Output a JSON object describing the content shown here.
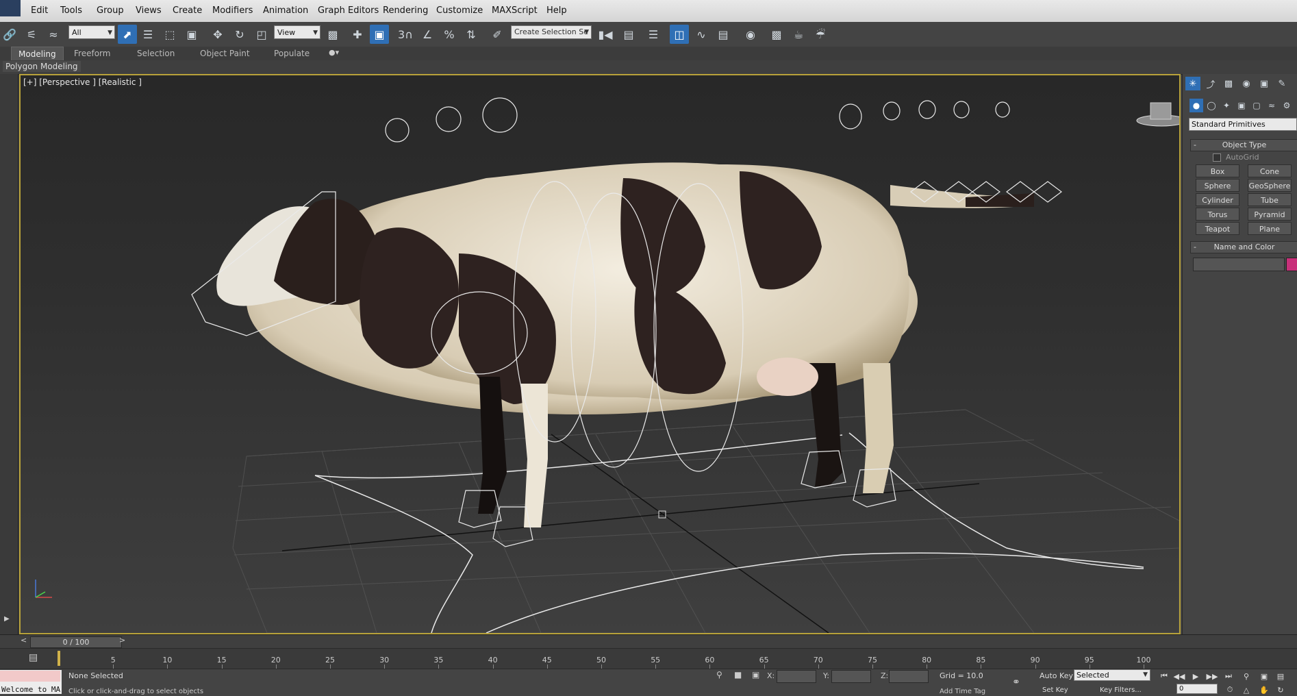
{
  "menu": {
    "items": [
      "Edit",
      "Tools",
      "Group",
      "Views",
      "Create",
      "Modifiers",
      "Animation",
      "Graph Editors",
      "Rendering",
      "Customize",
      "MAXScript",
      "Help"
    ]
  },
  "toolbar": {
    "selection_filter": "All",
    "reference_coord": "View",
    "named_selection_placeholder": "Create Selection Se",
    "icons": [
      "link-icon",
      "unlink-icon",
      "bind-space-warp-icon",
      "select-object-icon",
      "select-by-name-icon",
      "rect-selection-region-icon",
      "window-crossing-icon",
      "move-icon",
      "rotate-icon",
      "scale-icon",
      "pivot-icon",
      "manipulate-icon",
      "keyboard-shortcut-override-icon",
      "snap-icon",
      "angle-snap-icon",
      "percent-snap-icon",
      "spinner-snap-icon",
      "edit-named-selection-icon",
      "mirror-icon",
      "align-icon",
      "layer-manager-icon",
      "scene-explorer-icon",
      "curve-editor-icon",
      "schematic-view-icon",
      "material-editor-icon",
      "render-setup-icon",
      "rendered-frame-window-icon",
      "render-icon"
    ],
    "snap_label": "3"
  },
  "ribbon": {
    "tabs": [
      "Modeling",
      "Freeform",
      "Selection",
      "Object Paint",
      "Populate"
    ],
    "active_tab": "Modeling",
    "panel_label": "Polygon Modeling"
  },
  "viewport": {
    "label": "[+] [Perspective ] [Realistic ]",
    "subject": "cow model with rig"
  },
  "command_panel": {
    "tabs": [
      "create-tab",
      "modify-tab",
      "hierarchy-tab",
      "motion-tab",
      "display-tab",
      "utilities-tab"
    ],
    "subtabs": [
      "geometry-icon",
      "shapes-icon",
      "lights-icon",
      "cameras-icon",
      "helpers-icon",
      "space-warps-icon",
      "systems-icon"
    ],
    "category": "Standard Primitives",
    "object_type_title": "Object Type",
    "autogrid_label": "AutoGrid",
    "primitives": [
      "Box",
      "Cone",
      "Sphere",
      "GeoSphere",
      "Cylinder",
      "Tube",
      "Torus",
      "Pyramid",
      "Teapot",
      "Plane"
    ],
    "name_color_title": "Name and Color",
    "object_color": "#c8307a"
  },
  "timeslider": {
    "readout": "0 / 100",
    "prev": "<",
    "next": ">"
  },
  "trackbar": {
    "ticks": [
      "5",
      "10",
      "15",
      "20",
      "25",
      "30",
      "35",
      "40",
      "45",
      "50",
      "55",
      "60",
      "65",
      "70",
      "75",
      "80",
      "85",
      "90",
      "95",
      "100"
    ]
  },
  "status": {
    "maxscript_text": "Welcome to MA",
    "selection": "None Selected",
    "prompt": "Click or click-and-drag to select objects",
    "x_label": "X:",
    "y_label": "Y:",
    "z_label": "Z:",
    "grid": "Grid = 10.0",
    "add_time_tag": "Add Time Tag",
    "auto_key": "Auto Key",
    "set_key": "Set Key",
    "key_mode": "Selected",
    "key_filters": "Key Filters...",
    "frame": "0"
  }
}
